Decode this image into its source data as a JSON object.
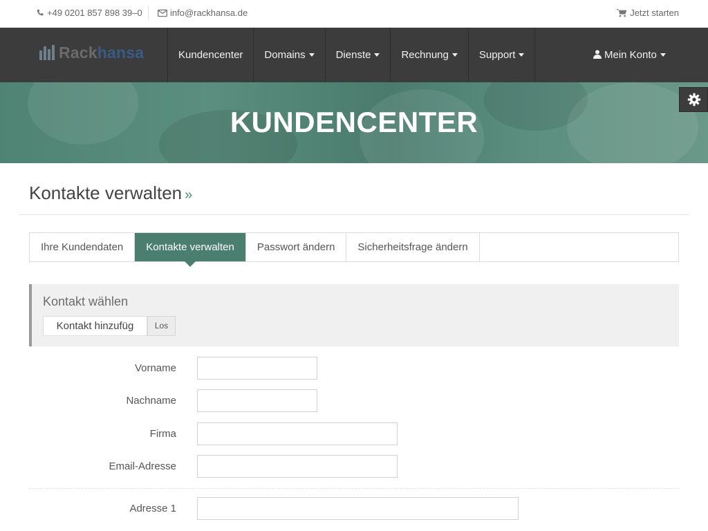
{
  "topbar": {
    "phone": "+49 0201 857 898 39–0",
    "email": "info@rackhansa.de",
    "cart_label": "Jetzt starten"
  },
  "logo": {
    "part1": "Rack",
    "part2": "hansa"
  },
  "nav": {
    "items": [
      {
        "label": "Kundencenter",
        "dropdown": false
      },
      {
        "label": "Domains",
        "dropdown": true
      },
      {
        "label": "Dienste",
        "dropdown": true
      },
      {
        "label": "Rechnung",
        "dropdown": true
      },
      {
        "label": "Support",
        "dropdown": true
      }
    ],
    "account_label": "Mein Konto"
  },
  "banner": {
    "title": "KUNDENCENTER"
  },
  "page": {
    "title": "Kontakte verwalten",
    "title_suffix": "»"
  },
  "tabs": [
    {
      "label": "Ihre Kundendaten",
      "active": false
    },
    {
      "label": "Kontakte verwalten",
      "active": true
    },
    {
      "label": "Passwort ändern",
      "active": false
    },
    {
      "label": "Sicherheitsfrage ändern",
      "active": false
    }
  ],
  "contact_panel": {
    "title": "Kontakt wählen",
    "selected_value": "Kontakt hinzufüg",
    "go_button": "Los"
  },
  "form": {
    "first_name_label": "Vorname",
    "last_name_label": "Nachname",
    "company_label": "Firma",
    "email_label": "Email-Adresse",
    "address1_label": "Adresse 1",
    "first_name_value": "",
    "last_name_value": "",
    "company_value": "",
    "email_value": "",
    "address1_value": ""
  },
  "colors": {
    "accent": "#4a7f70",
    "navbar": "#3c3c3c",
    "logo_blue": "#3a5b86"
  },
  "icons": {
    "phone": "phone-icon",
    "email": "envelope-icon",
    "cart": "cart-icon",
    "user": "user-icon",
    "settings": "gear-icon"
  }
}
